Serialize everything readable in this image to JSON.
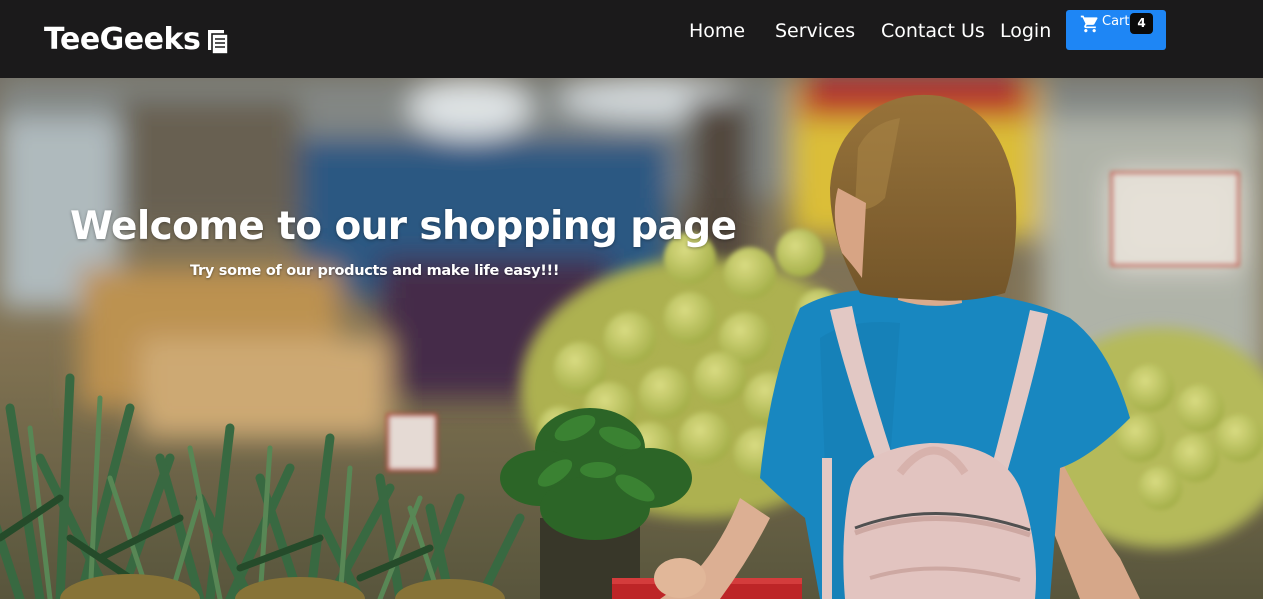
{
  "navbar": {
    "brand": "TeeGeeks",
    "brand_icon": "document-icon",
    "links": {
      "home": "Home",
      "services": "Services",
      "contact": "Contact Us",
      "login": "Login"
    },
    "cart": {
      "label": "Cart",
      "count": "4",
      "icon": "shopping-cart-icon",
      "color": "#1e86f5"
    },
    "background": "#1b1a1b"
  },
  "hero": {
    "title": "Welcome to our shopping page",
    "subtitle": "Try some of our products and make life easy!!!",
    "image": "woman-shopping-in-grocery-store-photo"
  }
}
